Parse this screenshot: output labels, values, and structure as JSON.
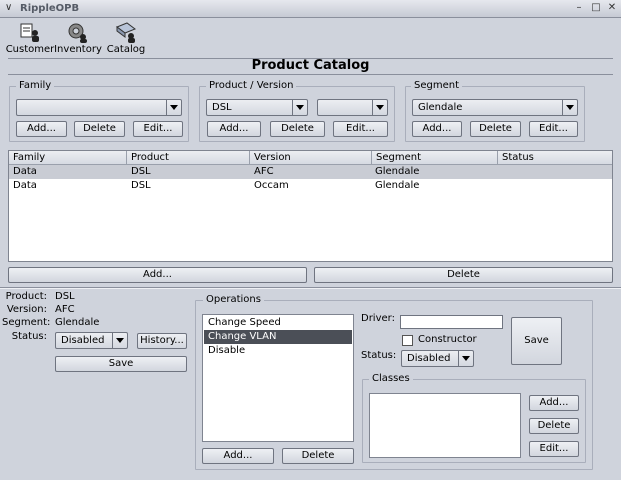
{
  "window": {
    "title": "RippleOPB",
    "controls": {
      "minimize": "–",
      "maximize": "□",
      "close": "✕"
    },
    "menu_caret": "∨"
  },
  "toolbar": {
    "customer": "Customer",
    "inventory": "Inventory",
    "catalog": "Catalog"
  },
  "page": {
    "title": "Product Catalog"
  },
  "family": {
    "legend": "Family",
    "selected": "",
    "add": "Add...",
    "delete": "Delete",
    "edit": "Edit..."
  },
  "product_version": {
    "legend": "Product / Version",
    "product_selected": "DSL",
    "version_selected": "",
    "add": "Add...",
    "delete": "Delete",
    "edit": "Edit..."
  },
  "segment": {
    "legend": "Segment",
    "selected": "Glendale",
    "add": "Add...",
    "delete": "Delete",
    "edit": "Edit..."
  },
  "table": {
    "columns": [
      "Family",
      "Product",
      "Version",
      "Segment",
      "Status"
    ],
    "rows": [
      [
        "Data",
        "DSL",
        "AFC",
        "Glendale",
        ""
      ],
      [
        "Data",
        "DSL",
        "Occam",
        "Glendale",
        ""
      ]
    ],
    "selected_row": 0
  },
  "table_actions": {
    "add": "Add...",
    "delete": "Delete"
  },
  "details": {
    "product_label": "Product:",
    "product_value": "DSL",
    "version_label": "Version:",
    "version_value": "AFC",
    "segment_label": "Segment:",
    "segment_value": "Glendale",
    "status_label": "Status:",
    "status_value": "Disabled",
    "history": "History...",
    "save": "Save"
  },
  "operations": {
    "legend": "Operations",
    "items": [
      "Change Speed",
      "Change VLAN",
      "Disable"
    ],
    "selected_index": 1,
    "add": "Add...",
    "delete": "Delete",
    "driver_label": "Driver:",
    "driver_value": "",
    "constructor_label": "Constructor",
    "constructor_checked": false,
    "status_label": "Status:",
    "status_value": "Disabled",
    "save": "Save"
  },
  "classes": {
    "legend": "Classes",
    "items": [],
    "add": "Add...",
    "delete": "Delete",
    "edit": "Edit..."
  }
}
